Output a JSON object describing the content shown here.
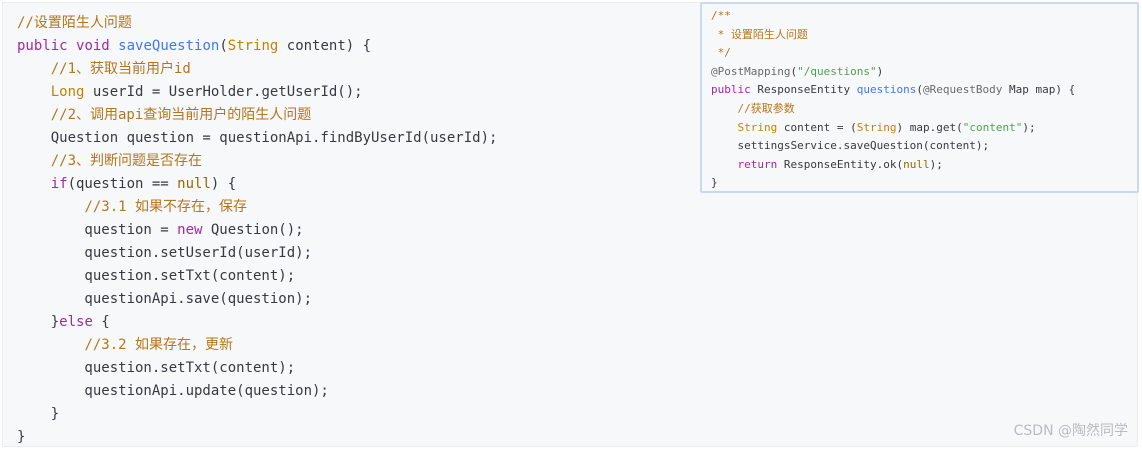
{
  "main_code": {
    "lines": [
      [
        {
          "t": "//设置陌生人问题",
          "c": "cm"
        }
      ],
      [
        {
          "t": "public",
          "c": "kw"
        },
        {
          "t": " "
        },
        {
          "t": "void",
          "c": "kw"
        },
        {
          "t": " "
        },
        {
          "t": "saveQuestion",
          "c": "fn"
        },
        {
          "t": "("
        },
        {
          "t": "String",
          "c": "ty"
        },
        {
          "t": " content) {"
        }
      ],
      [
        {
          "t": "    "
        },
        {
          "t": "//1、获取当前用户id",
          "c": "cm"
        }
      ],
      [
        {
          "t": "    "
        },
        {
          "t": "Long",
          "c": "ty"
        },
        {
          "t": " userId = UserHolder.getUserId();"
        }
      ],
      [
        {
          "t": "    "
        },
        {
          "t": "//2、调用api查询当前用户的陌生人问题",
          "c": "cm"
        }
      ],
      [
        {
          "t": "    Question question = questionApi.findByUserId(userId);"
        }
      ],
      [
        {
          "t": "    "
        },
        {
          "t": "//3、判断问题是否存在",
          "c": "cm"
        }
      ],
      [
        {
          "t": "    "
        },
        {
          "t": "if",
          "c": "kw"
        },
        {
          "t": "(question == "
        },
        {
          "t": "null",
          "c": "nu"
        },
        {
          "t": ") {"
        }
      ],
      [
        {
          "t": "        "
        },
        {
          "t": "//3.1 如果不存在，保存",
          "c": "cm"
        }
      ],
      [
        {
          "t": "        question = "
        },
        {
          "t": "new",
          "c": "kw"
        },
        {
          "t": " Question();"
        }
      ],
      [
        {
          "t": "        question.setUserId(userId);"
        }
      ],
      [
        {
          "t": "        question.setTxt(content);"
        }
      ],
      [
        {
          "t": "        questionApi.save(question);"
        }
      ],
      [
        {
          "t": "    }"
        },
        {
          "t": "else",
          "c": "kw"
        },
        {
          "t": " {"
        }
      ],
      [
        {
          "t": "        "
        },
        {
          "t": "//3.2 如果存在，更新",
          "c": "cm"
        }
      ],
      [
        {
          "t": "        question.setTxt(content);"
        }
      ],
      [
        {
          "t": "        questionApi.update(question);"
        }
      ],
      [
        {
          "t": "    }"
        }
      ],
      [
        {
          "t": "}"
        }
      ]
    ]
  },
  "popup_code": {
    "lines": [
      [
        {
          "t": "/**",
          "c": "cm"
        }
      ],
      [
        {
          "t": " * 设置陌生人问题",
          "c": "cm"
        }
      ],
      [
        {
          "t": " */",
          "c": "cm"
        }
      ],
      [
        {
          "t": "@PostMapping",
          "c": "an"
        },
        {
          "t": "("
        },
        {
          "t": "\"/questions\"",
          "c": "st"
        },
        {
          "t": ")"
        }
      ],
      [
        {
          "t": "public",
          "c": "kw"
        },
        {
          "t": " ResponseEntity "
        },
        {
          "t": "questions",
          "c": "fn"
        },
        {
          "t": "("
        },
        {
          "t": "@RequestBody",
          "c": "an"
        },
        {
          "t": " Map map) {"
        }
      ],
      [
        {
          "t": "    "
        },
        {
          "t": "//获取参数",
          "c": "cm"
        }
      ],
      [
        {
          "t": "    "
        },
        {
          "t": "String",
          "c": "ty"
        },
        {
          "t": " content = ("
        },
        {
          "t": "String",
          "c": "ty"
        },
        {
          "t": ") map.get("
        },
        {
          "t": "\"content\"",
          "c": "st"
        },
        {
          "t": ");"
        }
      ],
      [
        {
          "t": "    settingsService.saveQuestion(content);"
        }
      ],
      [
        {
          "t": "    "
        },
        {
          "t": "return",
          "c": "kw"
        },
        {
          "t": " ResponseEntity.ok("
        },
        {
          "t": "null",
          "c": "nu"
        },
        {
          "t": ");"
        }
      ],
      [
        {
          "t": "}"
        }
      ]
    ]
  },
  "watermark": "CSDN @陶然同学"
}
